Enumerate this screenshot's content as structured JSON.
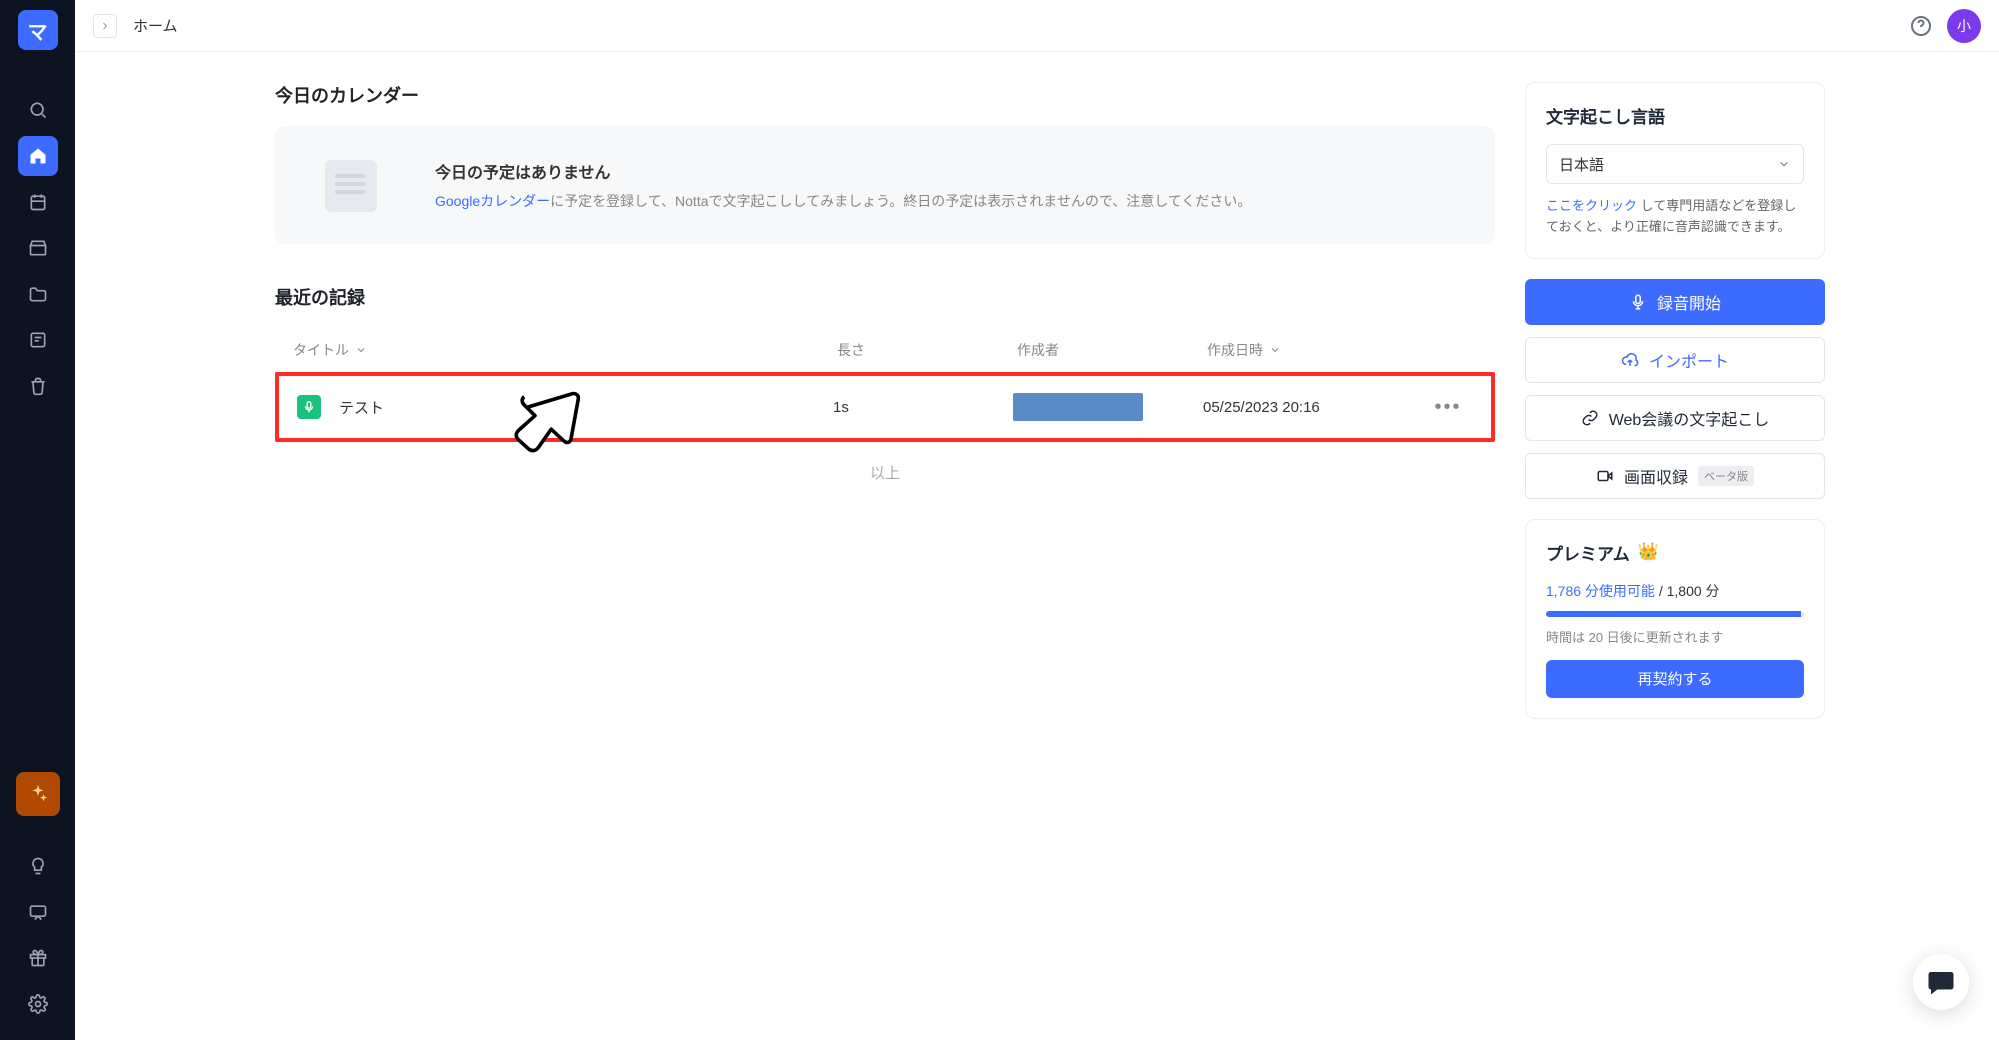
{
  "header": {
    "breadcrumb": "ホーム",
    "avatar_label": "小"
  },
  "calendar": {
    "section_title": "今日のカレンダー",
    "empty_title": "今日の予定はありません",
    "empty_body_link": "Googleカレンダー",
    "empty_body_rest": "に予定を登録して、Nottaで文字起こししてみましょう。終日の予定は表示されませんので、注意してください。"
  },
  "records": {
    "section_title": "最近の記録",
    "columns": {
      "title": "タイトル",
      "length": "長さ",
      "author": "作成者",
      "date": "作成日時"
    },
    "rows": [
      {
        "title": "テスト",
        "length": "1s",
        "author_redacted": true,
        "date": "05/25/2023 20:16"
      }
    ],
    "end_marker": "以上"
  },
  "lang_panel": {
    "title": "文字起こし言語",
    "selected": "日本語",
    "hint_link": "ここをクリック",
    "hint_rest": " して専門用語などを登録しておくと、より正確に音声認識できます。"
  },
  "actions": {
    "record": "録音開始",
    "import": "インポート",
    "web_meeting": "Web会議の文字起こし",
    "screen_rec": "画面収録",
    "beta": "ベータ版"
  },
  "premium": {
    "title": "プレミアム",
    "usage_used": "1,786 分使用可能",
    "usage_separator": " / ",
    "usage_total": "1,800 分",
    "renew_text": "時間は 20 日後に更新されます",
    "renew_button": "再契約する"
  }
}
